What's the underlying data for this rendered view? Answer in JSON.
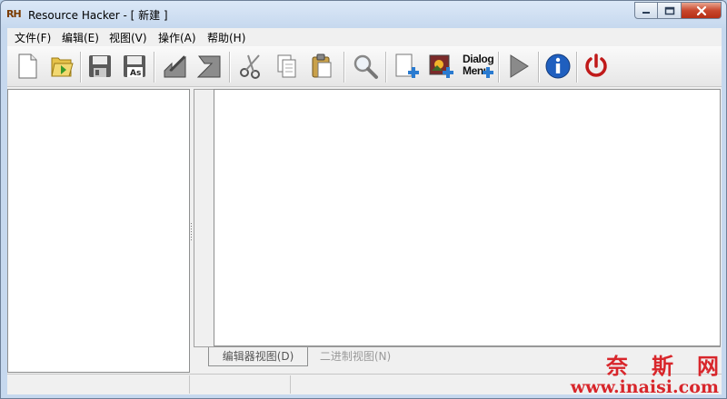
{
  "window": {
    "app_icon_text": "RH",
    "title": "Resource Hacker - [ 新建 ]"
  },
  "menu": [
    {
      "label": "文件(F)"
    },
    {
      "label": "编辑(E)"
    },
    {
      "label": "视图(V)"
    },
    {
      "label": "操作(A)"
    },
    {
      "label": "帮助(H)"
    }
  ],
  "toolbar": {
    "dialog_menu_line1": "Dialog",
    "dialog_menu_line2": "Menu",
    "save_as_text": "As",
    "icons": [
      "new-file-icon",
      "open-folder-icon",
      "save-icon",
      "save-as-icon",
      "import-arrow-icon",
      "export-arrow-icon",
      "cut-icon",
      "copy-icon",
      "paste-icon",
      "search-icon",
      "add-resource-icon",
      "add-image-resource-icon",
      "dialog-menu-icon",
      "compile-run-icon",
      "about-info-icon",
      "exit-power-icon"
    ]
  },
  "tabs": {
    "editor_view": "编辑器视图(D)",
    "binary_view": "二进制视图(N)"
  },
  "watermark": {
    "chinese": "奈斯网",
    "url": "www.inaisi.com"
  }
}
